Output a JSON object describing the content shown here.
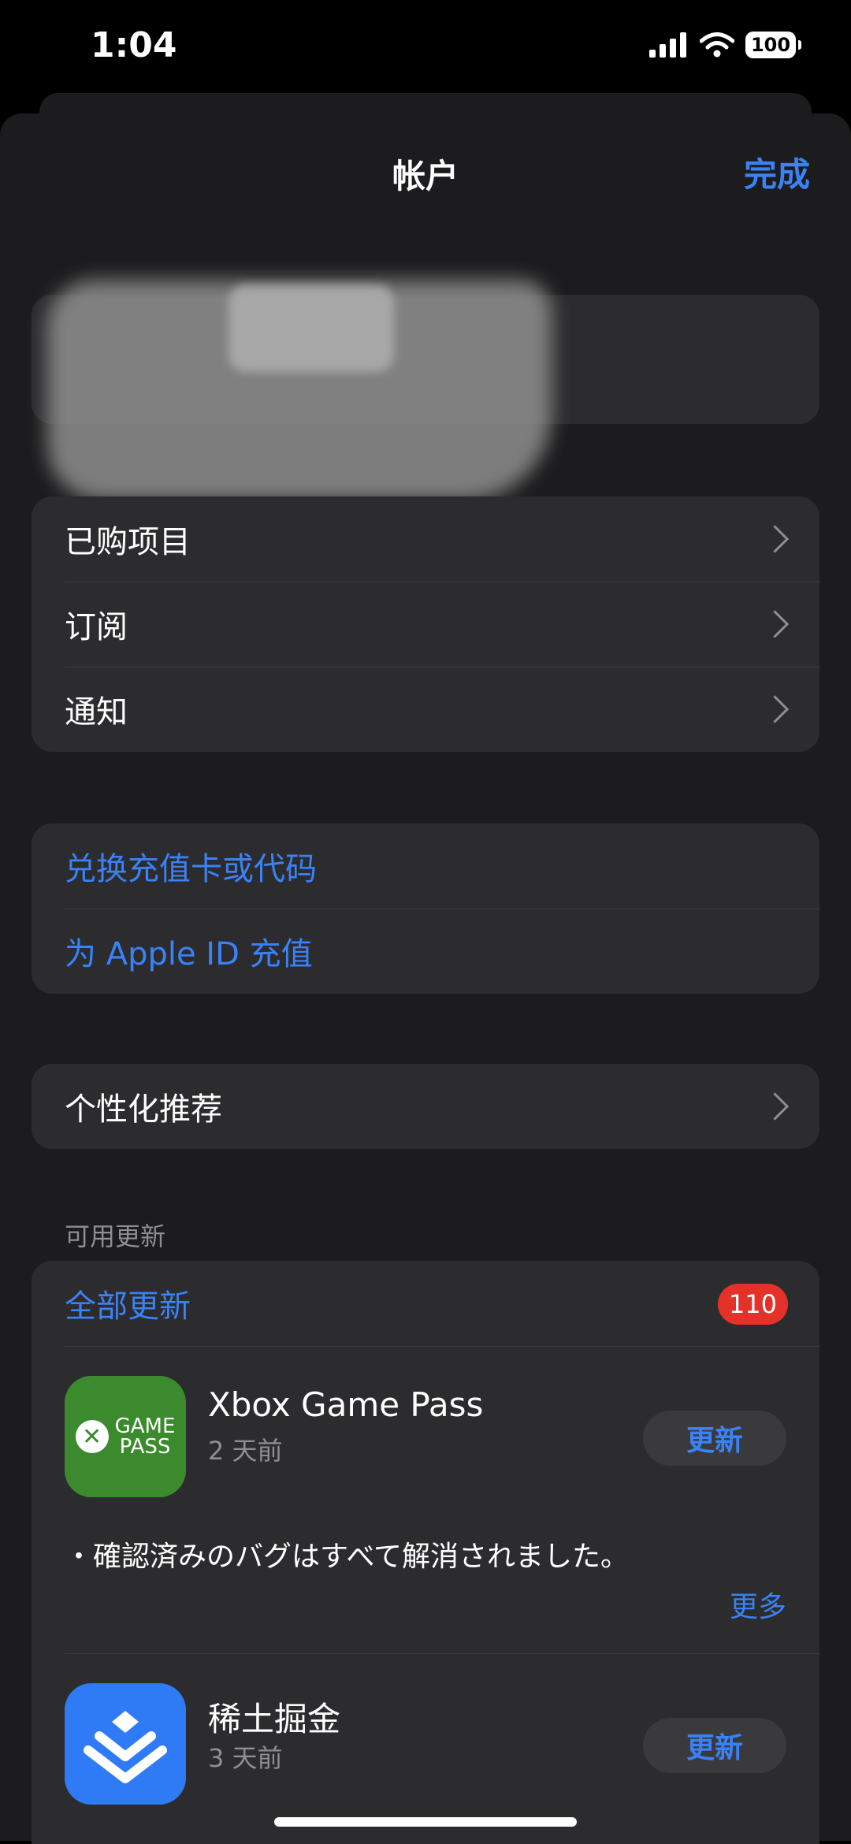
{
  "status_bar": {
    "time": "1:04",
    "battery": "100"
  },
  "nav": {
    "title": "帐户",
    "done_label": "完成"
  },
  "account_menu": [
    {
      "label": "已购项目"
    },
    {
      "label": "订阅"
    },
    {
      "label": "通知"
    }
  ],
  "funds_menu": [
    {
      "label": "兑换充值卡或代码"
    },
    {
      "label": "为 Apple ID 充值"
    }
  ],
  "personalization": {
    "label": "个性化推荐"
  },
  "updates": {
    "section_label": "可用更新",
    "update_all_label": "全部更新",
    "count": "110",
    "apps": [
      {
        "name": "Xbox Game Pass",
        "age": "2 天前",
        "button_label": "更新",
        "icon_text_top": "GAME",
        "icon_text_bottom": "PASS",
        "icon_color": "#3c8a2e",
        "release_notes": "・確認済みのバグはすべて解消されました。",
        "more_label": "更多"
      },
      {
        "name": "稀土掘金",
        "age": "3 天前",
        "button_label": "更新",
        "icon_color": "#2f7bf5"
      }
    ]
  },
  "colors": {
    "accent": "#3a82f7",
    "badge": "#e4322b",
    "sheet": "#1c1c1e",
    "cell": "#2c2c2e"
  }
}
